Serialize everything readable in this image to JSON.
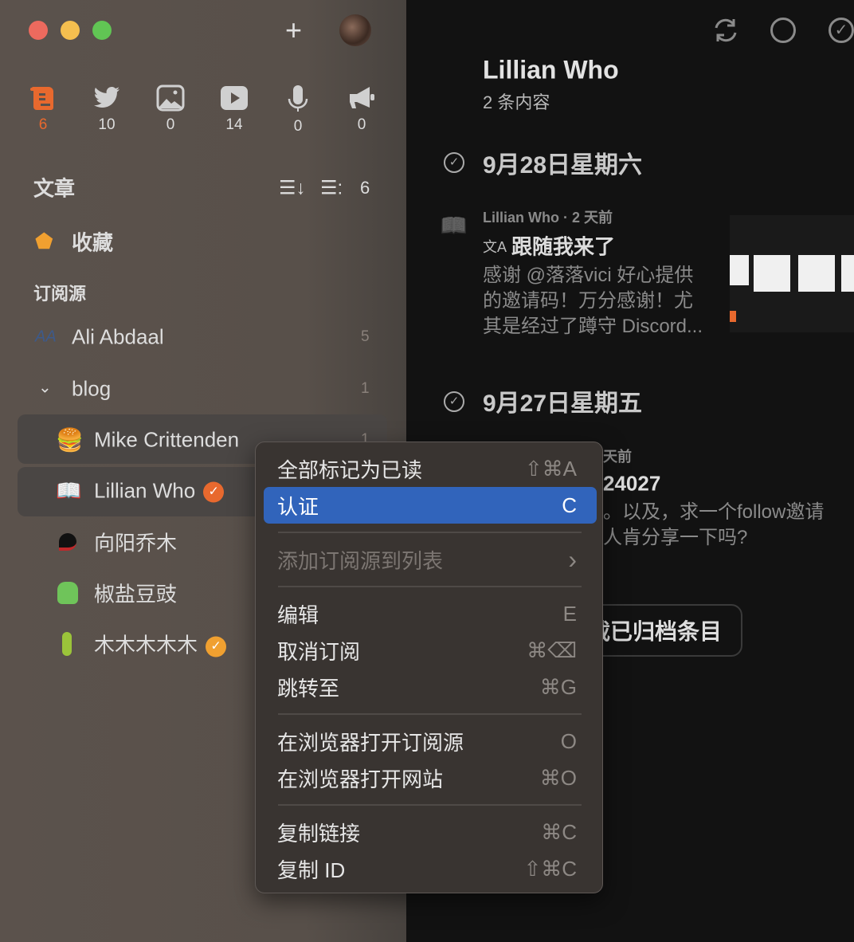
{
  "window": {
    "colors": {
      "close": "#ed6a5e",
      "minimize": "#f5bf4f",
      "zoom": "#61c554",
      "accent": "#e8692e",
      "highlight": "#3164bb"
    }
  },
  "sidebar": {
    "categories": [
      {
        "icon": "article-scroll-icon",
        "count": "6",
        "active": true
      },
      {
        "icon": "twitter-bird-icon",
        "count": "10"
      },
      {
        "icon": "image-icon",
        "count": "0"
      },
      {
        "icon": "video-play-icon",
        "count": "14"
      },
      {
        "icon": "microphone-icon",
        "count": "0"
      },
      {
        "icon": "megaphone-icon",
        "count": "0"
      }
    ],
    "section_title": "文章",
    "unread_count": "6",
    "favorites": "收藏",
    "subscriptions_title": "订阅源",
    "feeds": [
      {
        "name": "Ali Abdaal",
        "count": "5"
      },
      {
        "name": "blog",
        "count": "1"
      },
      {
        "name": "Mike Crittenden",
        "count": "1"
      },
      {
        "name": "Lillian Who",
        "verified": true
      },
      {
        "name": "向阳乔木"
      },
      {
        "name": "椒盐豆豉"
      },
      {
        "name": "木木木木木",
        "verified": true
      }
    ]
  },
  "menu": {
    "items": [
      {
        "label": "全部标记为已读",
        "shortcut": "⇧⌘A"
      },
      {
        "label": "认证",
        "shortcut": "C",
        "highlighted": true
      },
      {
        "label": "添加订阅源到列表",
        "shortcut": "›",
        "disabled": true
      },
      {
        "label": "编辑",
        "shortcut": "E"
      },
      {
        "label": "取消订阅",
        "shortcut": "⌘⌫"
      },
      {
        "label": "跳转至",
        "shortcut": "⌘G"
      },
      {
        "label": "在浏览器打开订阅源",
        "shortcut": "O"
      },
      {
        "label": "在浏览器打开网站",
        "shortcut": "⌘O"
      },
      {
        "label": "复制链接",
        "shortcut": "⌘C"
      },
      {
        "label": "复制 ID",
        "shortcut": "⇧⌘C"
      }
    ]
  },
  "main": {
    "title": "Lillian Who",
    "subtitle": "2 条内容",
    "groups": [
      {
        "date": "9月28日星期六",
        "entry": {
          "meta": "Lillian Who · 2 天前",
          "title": "跟随我来了",
          "lines": [
            "感谢 @落落vici 好心提供",
            "的邀请码！万分感谢！尤",
            "其是经过了蹲守 Discord..."
          ]
        }
      },
      {
        "date": "9月27日星期五",
        "entry": {
          "meta": "天前",
          "title": "24027",
          "lines": [
            "。以及，求一个follow邀请",
            "人肯分享一下吗?"
          ]
        }
      }
    ],
    "load_archived": "加载已归档条目"
  }
}
